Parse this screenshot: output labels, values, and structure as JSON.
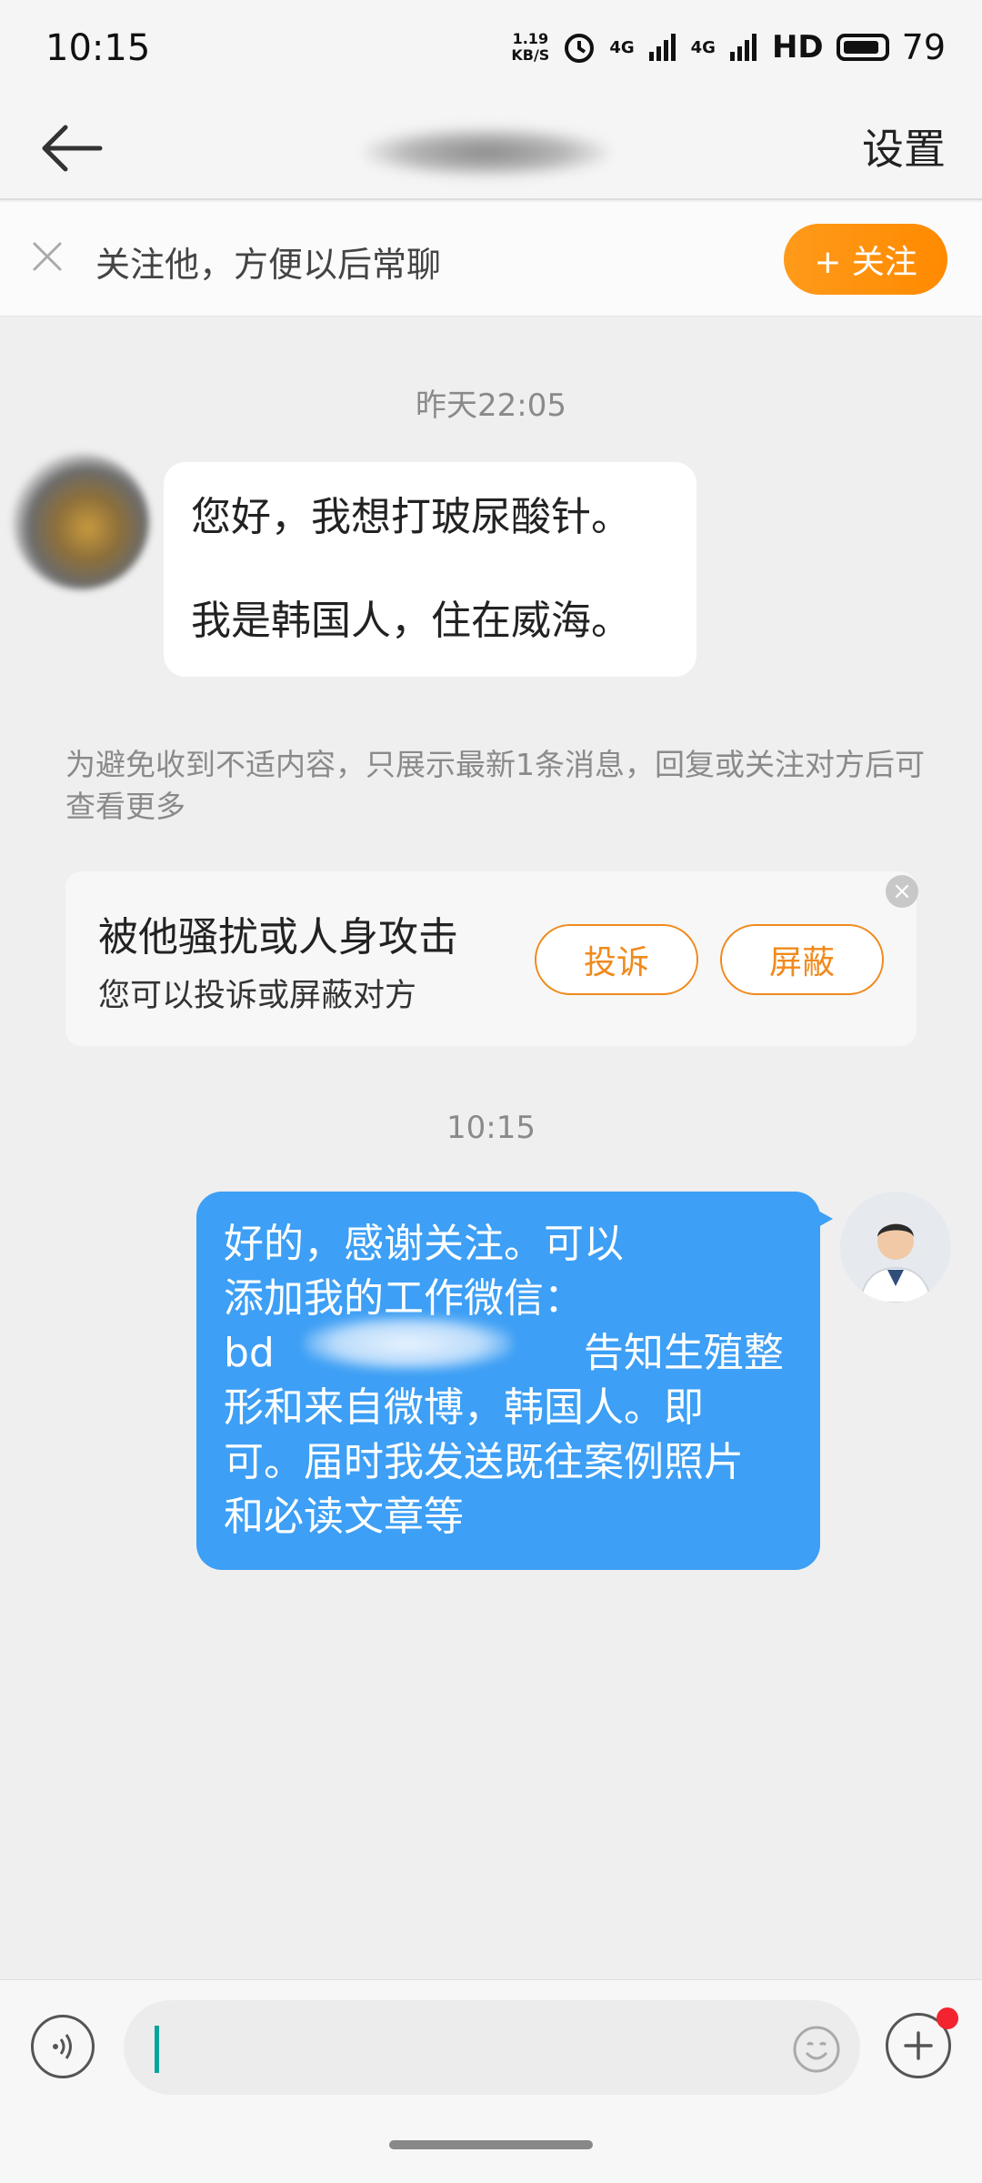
{
  "status_bar": {
    "time": "10:15",
    "net_speed_value": "1.19",
    "net_speed_unit": "KB/S",
    "network_1": "4G",
    "network_2": "4G",
    "hd": "HD",
    "battery": "79"
  },
  "nav": {
    "title_blurred": "",
    "settings_label": "设置"
  },
  "follow_banner": {
    "text": "关注他，方便以后常聊",
    "button_label": "+ 关注",
    "accent_color": "#ff9a1a"
  },
  "chat": {
    "timestamp_1": "昨天22:05",
    "incoming": {
      "line_1": "您好，我想打玻尿酸针。",
      "line_2": "我是韩国人，住在威海。"
    },
    "notice": "为避免收到不适内容，只展示最新1条消息，回复或关注对方后可查看更多",
    "report_card": {
      "title": "被他骚扰或人身攻击",
      "subtitle": "您可以投诉或屏蔽对方",
      "complain_label": "投诉",
      "block_label": "屏蔽"
    },
    "timestamp_2": "10:15",
    "outgoing": {
      "line_1": "好的，感谢关注。可以",
      "line_2": "添加我的工作微信：",
      "line_3_prefix": "bd",
      "line_3_suffix": "告知生殖整",
      "line_4": "形和来自微博，韩国人。即",
      "line_5": "可。届时我发送既往案例照片",
      "line_6": "和必读文章等",
      "bubble_color": "#3d9ff5"
    }
  },
  "input_bar": {
    "placeholder": ""
  }
}
